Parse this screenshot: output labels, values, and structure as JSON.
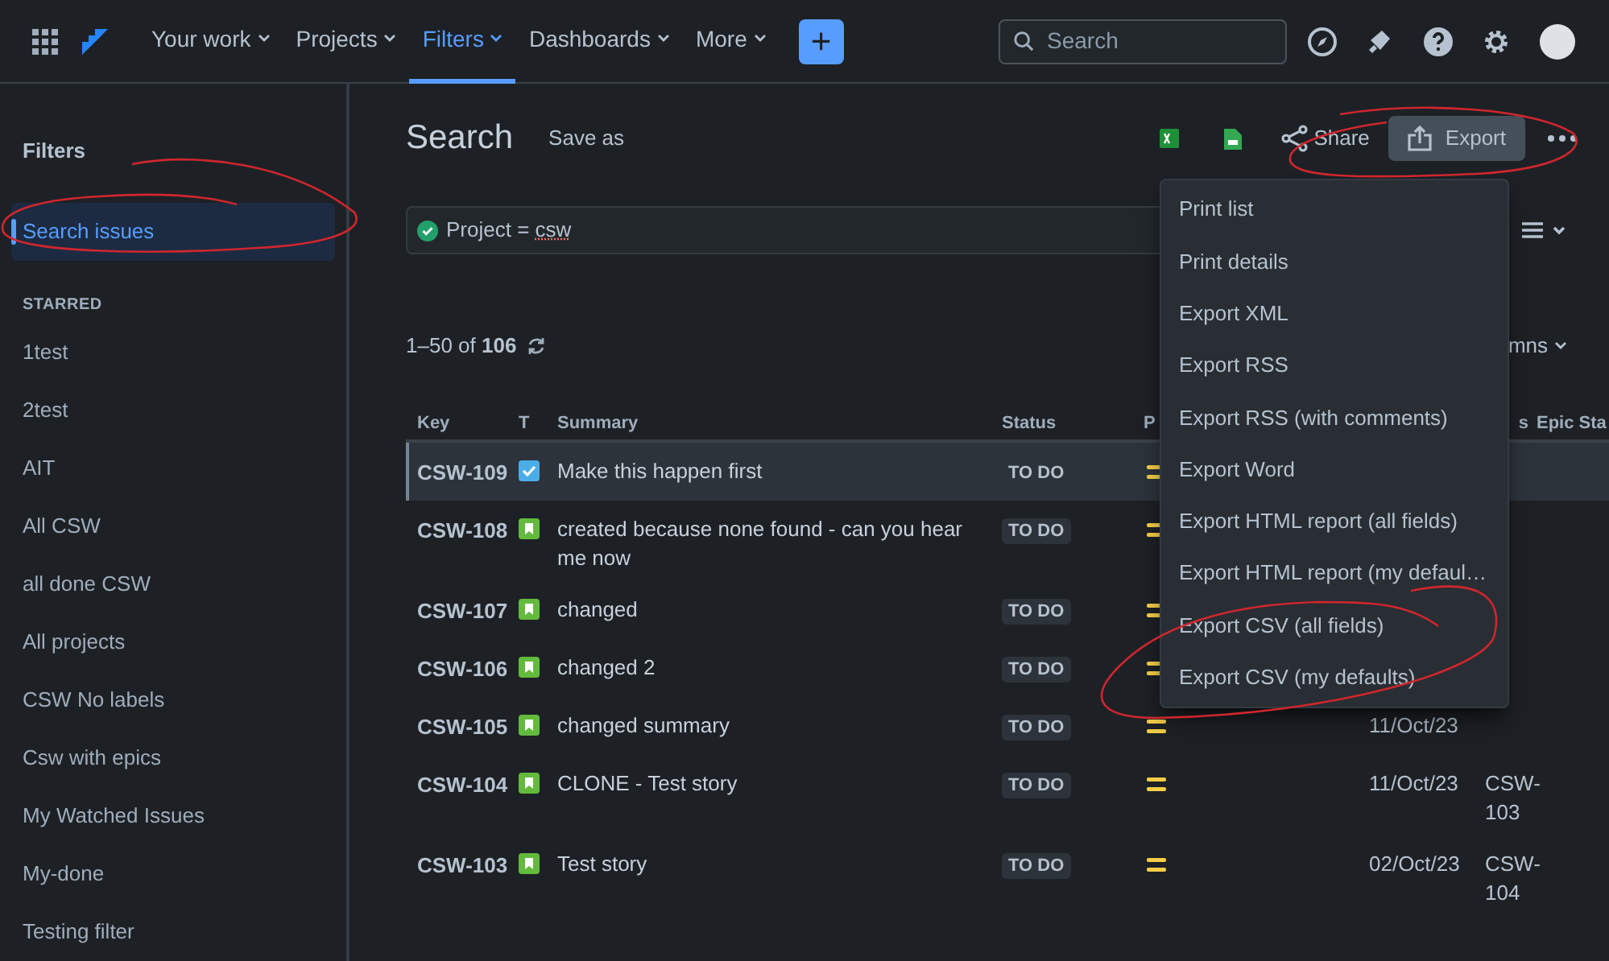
{
  "nav": {
    "items": [
      {
        "label": "Your work",
        "selected": false
      },
      {
        "label": "Projects",
        "selected": false
      },
      {
        "label": "Filters",
        "selected": true
      },
      {
        "label": "Dashboards",
        "selected": false
      },
      {
        "label": "More",
        "selected": false
      }
    ],
    "create_button": "+",
    "search": {
      "placeholder": "Search"
    }
  },
  "sidebar": {
    "title": "Filters",
    "items": [
      {
        "label": "Search issues",
        "selected": true
      }
    ],
    "section": "STARRED",
    "starred": [
      {
        "label": "1test",
        "selected": false
      },
      {
        "label": "2test",
        "selected": false
      },
      {
        "label": "AIT",
        "selected": false
      },
      {
        "label": "All CSW",
        "selected": false
      },
      {
        "label": "all done CSW",
        "selected": false
      },
      {
        "label": "All projects",
        "selected": false
      },
      {
        "label": "CSW No labels",
        "selected": false
      },
      {
        "label": "Csw with epics",
        "selected": false
      },
      {
        "label": "My Watched Issues",
        "selected": false
      },
      {
        "label": "My-done",
        "selected": false
      },
      {
        "label": "Testing filter",
        "selected": false
      }
    ]
  },
  "header": {
    "title": "Search",
    "save_as": "Save as",
    "share": "Share",
    "export": "Export"
  },
  "query": {
    "text": "Project = ",
    "project": "csw"
  },
  "results": {
    "count": "1–50 of **106**",
    "columns_button": "mns"
  },
  "table": {
    "columns": [
      "Key",
      "T",
      "Summary",
      "Status",
      "P",
      "",
      "s",
      "Epic Sta"
    ],
    "rows": [
      {
        "key": "CSW-109",
        "kind": "task",
        "summary": "Make this happen first",
        "status": "TO DO",
        "date": "",
        "link": "",
        "selected": true
      },
      {
        "key": "CSW-108",
        "kind": "story",
        "summary": "created because none found - can you hear me now",
        "status": "TO DO",
        "date": "",
        "link": "",
        "selected": false
      },
      {
        "key": "CSW-107",
        "kind": "story",
        "summary": "changed",
        "status": "TO DO",
        "date": "",
        "link": "",
        "selected": false
      },
      {
        "key": "CSW-106",
        "kind": "story",
        "summary": "changed 2",
        "status": "TO DO",
        "date": "",
        "link": "",
        "selected": false
      },
      {
        "key": "CSW-105",
        "kind": "story",
        "summary": "changed summary",
        "status": "TO DO",
        "date": "11/Oct/23",
        "link": "",
        "selected": false
      },
      {
        "key": "CSW-104",
        "kind": "story",
        "summary": "CLONE - Test story",
        "status": "TO DO",
        "date": "11/Oct/23",
        "link": "CSW-103",
        "selected": false
      },
      {
        "key": "CSW-103",
        "kind": "story",
        "summary": "Test story",
        "status": "TO DO",
        "date": "02/Oct/23",
        "link": "CSW-104",
        "selected": false
      }
    ]
  },
  "export_menu": [
    "Print list",
    "Print details",
    "Export XML",
    "Export RSS",
    "Export RSS (with comments)",
    "Export Word",
    "Export HTML report (all fields)",
    "Export HTML report (my defaul…",
    "Export CSV (all fields)",
    "Export CSV (my defaults)"
  ]
}
